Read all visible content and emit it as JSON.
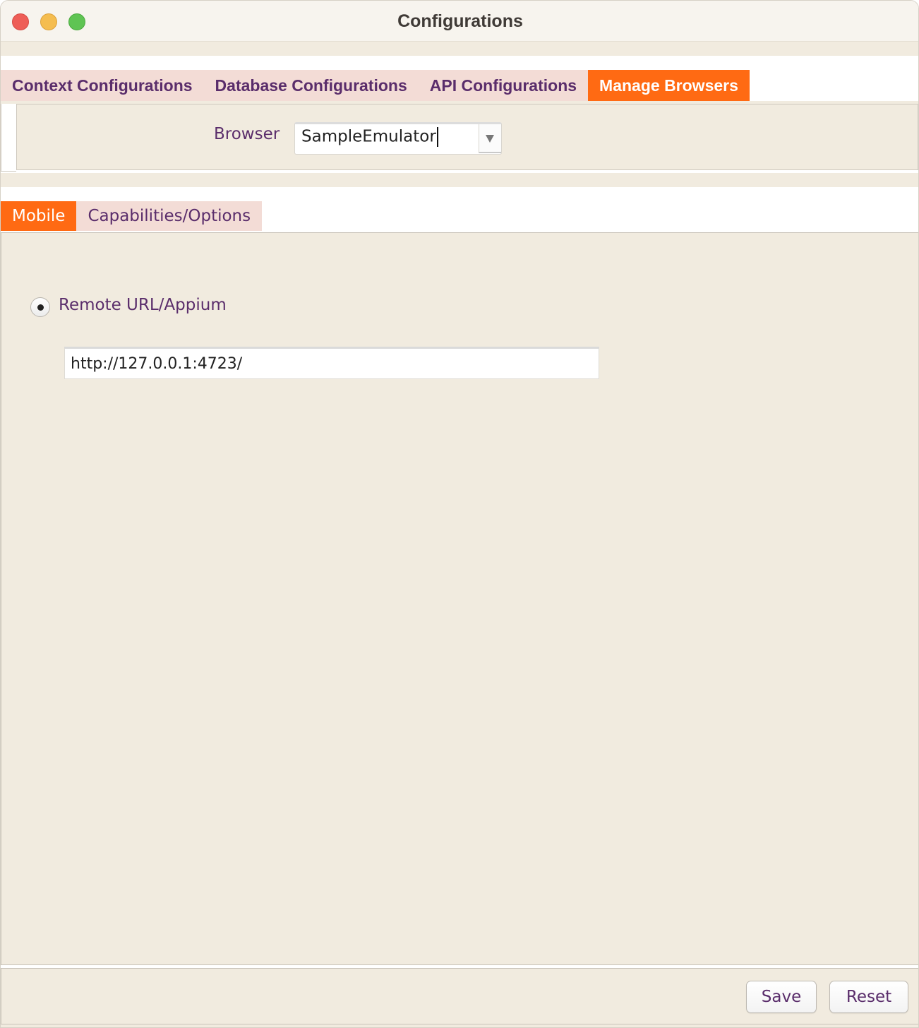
{
  "window": {
    "title": "Configurations"
  },
  "main_tabs": [
    {
      "label": "Context Configurations",
      "active": false
    },
    {
      "label": "Database Configurations",
      "active": false
    },
    {
      "label": "API Configurations",
      "active": false
    },
    {
      "label": "Manage Browsers",
      "active": true
    }
  ],
  "browser_panel": {
    "label": "Browser",
    "selected": "SampleEmulator"
  },
  "sub_tabs": [
    {
      "label": "Mobile",
      "active": true
    },
    {
      "label": "Capabilities/Options",
      "active": false
    }
  ],
  "mobile": {
    "radio_label": "Remote URL/Appium",
    "radio_selected": true,
    "url_value": "http://127.0.0.1:4723/"
  },
  "footer": {
    "save_label": "Save",
    "reset_label": "Reset"
  },
  "colors": {
    "active_tab": "#ff6a13",
    "inactive_tab": "#f3dcd6",
    "panel_bg": "#f1ebdf",
    "label_text": "#5a2d6b"
  }
}
